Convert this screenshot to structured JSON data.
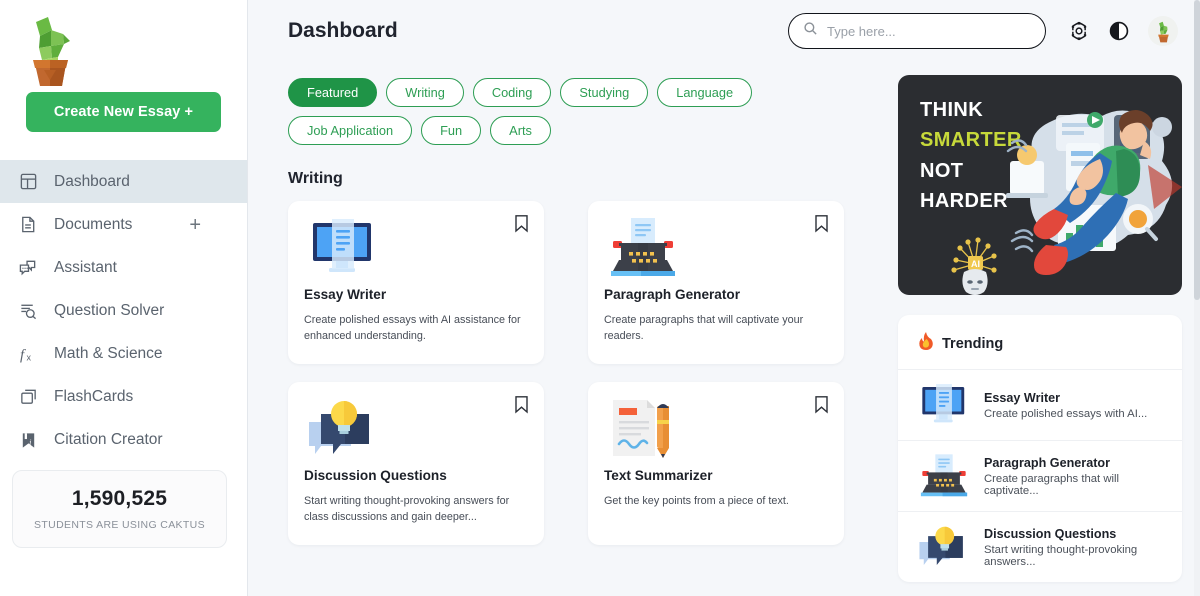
{
  "sidebar": {
    "logo_icon": "cactus-logo",
    "create_button": "Create New Essay +",
    "items": [
      {
        "label": "Dashboard",
        "icon": "dashboard-icon",
        "active": true
      },
      {
        "label": "Documents",
        "icon": "document-icon",
        "active": false,
        "trailing": "+"
      },
      {
        "label": "Assistant",
        "icon": "chat-bubbles-icon",
        "active": false
      },
      {
        "label": "Question Solver",
        "icon": "question-search-icon",
        "active": false
      },
      {
        "label": "Math & Science",
        "icon": "function-fx-icon",
        "active": false
      },
      {
        "label": "FlashCards",
        "icon": "cards-stack-icon",
        "active": false
      },
      {
        "label": "Citation Creator",
        "icon": "citation-book-icon",
        "active": false
      }
    ],
    "stats": {
      "number": "1,590,525",
      "label": "STUDENTS ARE USING CAKTUS"
    }
  },
  "header": {
    "title": "Dashboard",
    "search": {
      "placeholder": "Type here...",
      "value": "",
      "icon": "search-icon"
    },
    "icons": [
      {
        "name": "gear-icon"
      },
      {
        "name": "contrast-icon"
      },
      {
        "name": "avatar-cactus-icon"
      }
    ]
  },
  "filters": {
    "chips": [
      {
        "label": "Featured",
        "active": true
      },
      {
        "label": "Writing",
        "active": false
      },
      {
        "label": "Coding",
        "active": false
      },
      {
        "label": "Studying",
        "active": false
      },
      {
        "label": "Language",
        "active": false
      },
      {
        "label": "Job Application",
        "active": false
      },
      {
        "label": "Fun",
        "active": false
      },
      {
        "label": "Arts",
        "active": false
      }
    ]
  },
  "main": {
    "section_title": "Writing",
    "cards": [
      {
        "title": "Essay Writer",
        "desc": "Create polished essays with AI assistance for enhanced understanding.",
        "icon": "monitor-document-icon",
        "bookmark_icon": "bookmark-icon"
      },
      {
        "title": "Paragraph Generator",
        "desc": "Create paragraphs that will captivate your readers.",
        "icon": "typewriter-icon",
        "bookmark_icon": "bookmark-icon"
      },
      {
        "title": "Discussion Questions",
        "desc": "Start writing thought-provoking answers for class discussions and gain deeper...",
        "icon": "lightbulb-chat-icon",
        "bookmark_icon": "bookmark-icon"
      },
      {
        "title": "Text Summarizer",
        "desc": "Get the key points from a piece of text.",
        "icon": "document-pencil-icon",
        "bookmark_icon": "bookmark-icon"
      }
    ]
  },
  "promo": {
    "line1": "THINK",
    "line2": "SMARTER",
    "line3": "NOT",
    "line4": "HARDER",
    "accent_color": "#c7d93a",
    "background_color": "#2b2d31"
  },
  "trending": {
    "heading": "Trending",
    "heading_icon": "fire-icon",
    "items": [
      {
        "title": "Essay Writer",
        "desc": "Create polished essays with AI...",
        "icon": "monitor-document-icon"
      },
      {
        "title": "Paragraph Generator",
        "desc": "Create paragraphs that will captivate...",
        "icon": "typewriter-icon"
      },
      {
        "title": "Discussion Questions",
        "desc": "Start writing thought-provoking answers...",
        "icon": "lightbulb-chat-icon"
      }
    ]
  },
  "theme": {
    "brand_green": "#35b35e",
    "chip_green": "#2e9e54",
    "active_nav_bg": "#dfe7ec",
    "page_bg": "#f5f7fa"
  }
}
